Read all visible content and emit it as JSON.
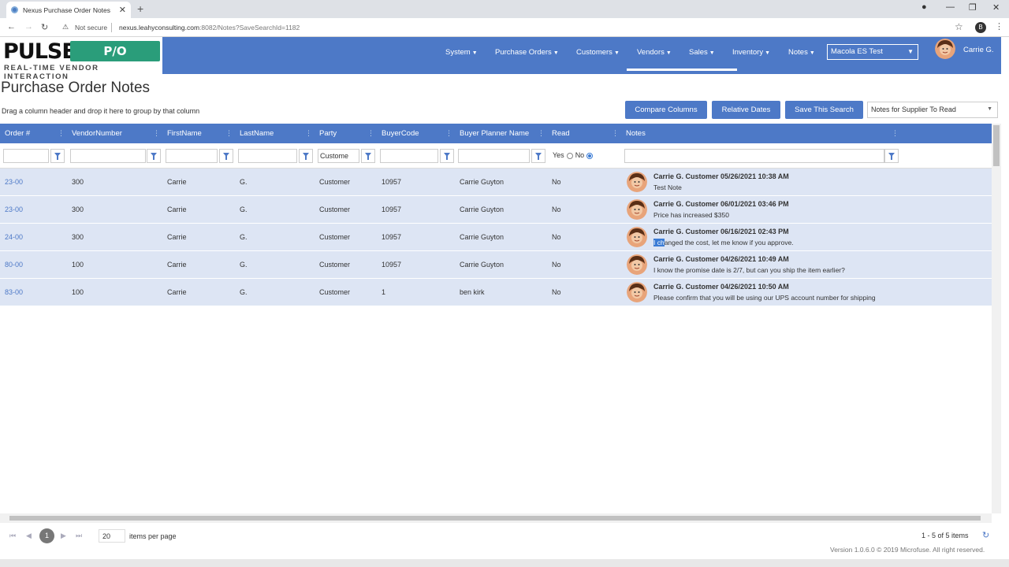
{
  "browser": {
    "tab_title": "Nexus Purchase Order Notes",
    "new_tab": "+",
    "not_secure": "Not secure",
    "url_host": "nexus.leahyconsulting.com",
    "url_path": ":8082/Notes?SaveSearchId=1182",
    "profile_initial": "B"
  },
  "logo": {
    "pulse": "PULSE",
    "po_manager": "P/O MANAGER",
    "tagline": "REAL-TIME VENDOR INTERACTION"
  },
  "menu": {
    "items": [
      "System",
      "Purchase Orders",
      "Customers",
      "Vendors",
      "Sales",
      "Inventory",
      "Notes"
    ],
    "company": "Macola ES Test",
    "user": "Carrie G."
  },
  "page": {
    "title": "Purchase Order Notes",
    "group_hint": "Drag a column header and drop it here to group by that column",
    "buttons": {
      "compare": "Compare Columns",
      "relative": "Relative Dates",
      "save": "Save This Search"
    },
    "saved_search": "Notes for Supplier To Read"
  },
  "grid": {
    "columns": [
      "Order #",
      "VendorNumber",
      "FirstName",
      "LastName",
      "Party",
      "BuyerCode",
      "Buyer Planner Name",
      "Read",
      "Notes"
    ],
    "filters": {
      "party": "Custome",
      "read_yes": "Yes",
      "read_no": "No",
      "read_selected": "No"
    },
    "rows": [
      {
        "order": "23-00",
        "vendor": "300",
        "first": "Carrie",
        "last": "G.",
        "party": "Customer",
        "buyer_code": "10957",
        "buyer_name": "Carrie Guyton",
        "read": "No",
        "note_header": "Carrie G. Customer 05/26/2021 10:38 AM",
        "note_text": "Test Note"
      },
      {
        "order": "23-00",
        "vendor": "300",
        "first": "Carrie",
        "last": "G.",
        "party": "Customer",
        "buyer_code": "10957",
        "buyer_name": "Carrie Guyton",
        "read": "No",
        "note_header": "Carrie G. Customer 06/01/2021 03:46 PM",
        "note_text": "Price has increased $350"
      },
      {
        "order": "24-00",
        "vendor": "300",
        "first": "Carrie",
        "last": "G.",
        "party": "Customer",
        "buyer_code": "10957",
        "buyer_name": "Carrie Guyton",
        "read": "No",
        "note_header": "Carrie G. Customer 06/16/2021 02:43 PM",
        "note_text_hl": "I ch",
        "note_text": "anged the cost, let me know if you approve."
      },
      {
        "order": "80-00",
        "vendor": "100",
        "first": "Carrie",
        "last": "G.",
        "party": "Customer",
        "buyer_code": "10957",
        "buyer_name": "Carrie Guyton",
        "read": "No",
        "note_header": "Carrie G. Customer 04/26/2021 10:49 AM",
        "note_text": "I know the promise date is 2/7, but can you ship the item earlier?"
      },
      {
        "order": "83-00",
        "vendor": "100",
        "first": "Carrie",
        "last": "G.",
        "party": "Customer",
        "buyer_code": "1",
        "buyer_name": "ben kirk",
        "read": "No",
        "note_header": "Carrie G. Customer 04/26/2021 10:50 AM",
        "note_text": "Please confirm that you will be using our UPS account number for shipping"
      }
    ]
  },
  "pager": {
    "current": "1",
    "per_page": "20",
    "per_page_label": "items per page",
    "info": "1 - 5 of 5 items"
  },
  "footer": {
    "version": "Version 1.0.6.0 © 2019 Microfuse. All right reserved."
  },
  "colors": {
    "brand_blue": "#4d79c7",
    "row_bg": "#dde5f4",
    "logo_green": "#2a9d7a"
  }
}
